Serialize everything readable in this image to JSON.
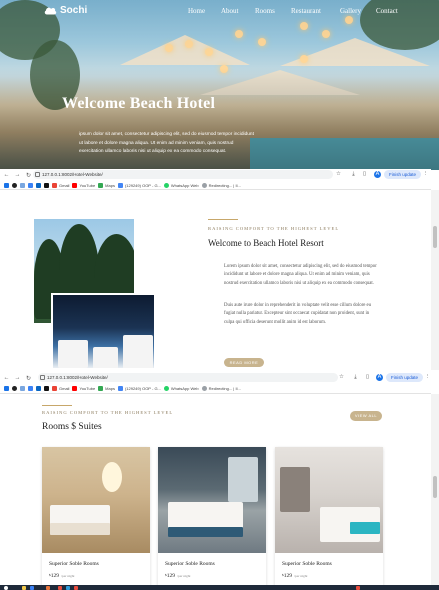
{
  "hero": {
    "logo_text": "Sochi",
    "nav": [
      "Home",
      "About",
      "Rooms",
      "Restaurant",
      "Gallery",
      "Contact"
    ],
    "title": "Welcome Beach Hotel",
    "text": "ipsum dolor sit amet, consectetur adipiscing elit, sed do eiusmod tempor incididunt ut labore et dolore magna aliqua. Ut enim ad minim veniam, quis nostrud exercitation ullamco laboris nisi ut aliquip ex ea commodo consequat."
  },
  "browser": {
    "url": "127.0.0.1:8002/Hotel-Website/",
    "finish_update": "Finish update",
    "bookmarks": [
      "Gmail",
      "YouTube",
      "Maps",
      "(129249) OOP - G...",
      "WhatsApp Web",
      "Redirecting... | Il..."
    ]
  },
  "about": {
    "eyebrow": "RAISING COMFORT TO THE HIGHEST LEVEL",
    "title": "Welcome to Beach Hotel Resort",
    "para1": "Lorem ipsum dolor sit amet, consectetur adipiscing elit, sed do eiusmod tempor incididunt ut labore et dolore magna aliqua. Ut enim ad minim veniam, quis nostrud exercitation ullamco laboris nisi ut aliquip ex ea commodo consequat.",
    "para2": "Duis aute irure dolor in reprehenderit in voluptate velit esse cillum dolore eu fugiat nulla pariatur. Excepteur sint occaecat cupidatat non proident, sunt in culpa qui officia deserunt mollit anim id est laborum.",
    "button": "READ MORE"
  },
  "rooms": {
    "eyebrow": "RAISING COMFORT TO THE HIGHEST LEVEL",
    "title": "Rooms $ Suites",
    "view_all": "VIEW ALL",
    "cards": [
      {
        "title": "Superior Soble Rooms",
        "currency": "$",
        "price": "129",
        "per": "/per night"
      },
      {
        "title": "Superior Soble Rooms",
        "currency": "$",
        "price": "129",
        "per": "/per night"
      },
      {
        "title": "Superior Soble Rooms",
        "currency": "$",
        "price": "129",
        "per": "/per night"
      }
    ]
  },
  "colors": {
    "accent_gold": "#c8b48e",
    "chrome_blue": "#1a5cd6"
  }
}
